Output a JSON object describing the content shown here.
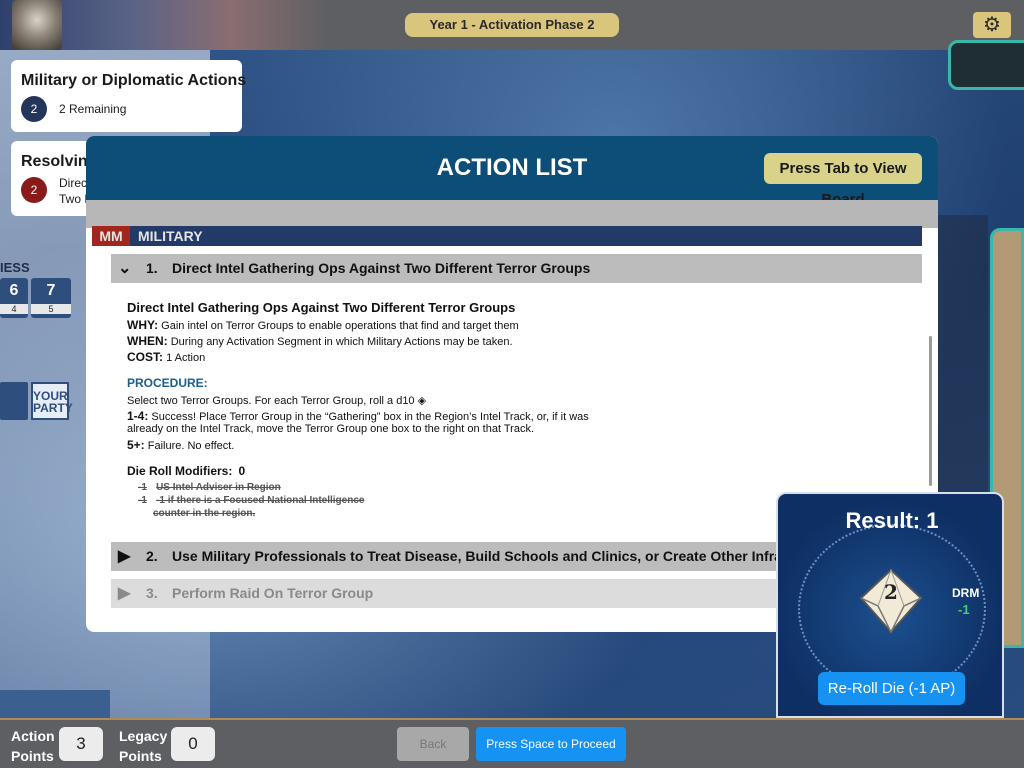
{
  "top_bar": {
    "turn_label": "Year 1  -  Activation Phase 2",
    "settings_icon": "gear-icon"
  },
  "left_panel": {
    "actions_card": {
      "title": "Military or Diplomatic Actions",
      "count": "2",
      "remaining": "2 Remaining"
    },
    "resolving_card": {
      "title": "Resolving",
      "count": "2",
      "line1": "Direct",
      "line2": "Two D"
    },
    "track_label": "IESS",
    "track_cells": [
      {
        "big": "6",
        "small": "4"
      },
      {
        "big": "7",
        "small": "5"
      }
    ],
    "party_box_label": "YOUR PARTY"
  },
  "action_list": {
    "title": "ACTION LIST",
    "tab_button": "Press Tab to View Board",
    "section_code": "MM",
    "section_name": "MILITARY",
    "actions": [
      {
        "number": "1.",
        "name": "Direct Intel Gathering Ops Against Two Different Terror Groups",
        "expanded": true
      },
      {
        "number": "2.",
        "name": "Use Military Professionals to Treat Disease, Build Schools and Clinics, or Create Other Infrastructure in",
        "expanded": false
      },
      {
        "number": "3.",
        "name": "Perform Raid On Terror Group",
        "expanded": false
      }
    ],
    "detail": {
      "title": "Direct Intel Gathering Ops Against Two Different Terror Groups",
      "why_label": "WHY:",
      "why_text": "Gain intel on Terror Groups to enable operations that find and target them",
      "when_label": "WHEN:",
      "when_text": "During any Activation Segment in which Military Actions may be taken.",
      "cost_label": "COST:",
      "cost_text": "1 Action",
      "procedure_heading": "PROCEDURE:",
      "procedure_intro": "Select two Terror Groups. For each Terror Group, roll a d10",
      "success_label": "1-4:",
      "success_text_1": "Success! Place Terror Group in the “Gathering” box in the Region’s Intel Track, or, if it was",
      "success_text_2": "already on the Intel Track, move the Terror Group one box to the right on that Track.",
      "failure_label": "5+:",
      "failure_text": "Failure. No effect.",
      "drm_heading": "Die Roll Modifiers:",
      "drm_total": "0",
      "modifiers": [
        {
          "value": "-1",
          "text": "US Intel Adviser in Region"
        },
        {
          "value": "-1",
          "text": "-1 if there is a Focused National Intelligence"
        }
      ],
      "modifier_continuation": "counter in the region."
    }
  },
  "result_panel": {
    "title": "Result: 1",
    "die_value": "2",
    "drm_label": "DRM",
    "drm_value": "-1",
    "reroll_button": "Re-Roll Die (-1 AP)"
  },
  "bottom_bar": {
    "action_points_label_1": "Action",
    "action_points_label_2": "Points",
    "action_points_value": "3",
    "legacy_points_label_1": "Legacy",
    "legacy_points_label_2": "Points",
    "legacy_points_value": "0",
    "back_button": "Back",
    "proceed_button": "Press Space to Proceed"
  },
  "colors": {
    "header_blue": "#0d4e78",
    "accent_gold": "#d9c57c",
    "button_blue": "#1592f2",
    "military_red": "#a1261e",
    "drm_green": "#3fd46b"
  }
}
